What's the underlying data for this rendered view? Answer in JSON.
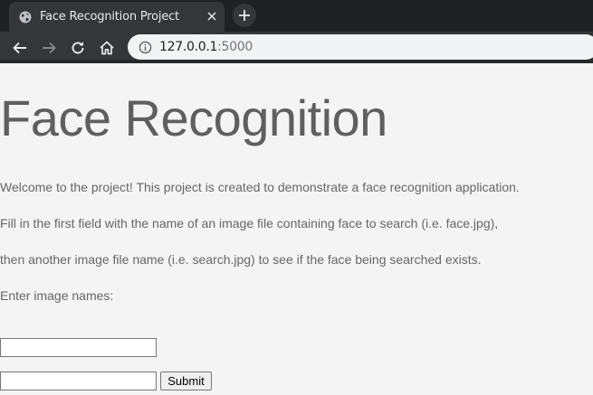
{
  "browser": {
    "tab_title": "Face Recognition Project",
    "url_host": "127.0.0.1",
    "url_port": ":5000"
  },
  "page": {
    "heading": "Face Recognition",
    "intro": "Welcome to the project! This project is created to demonstrate a face recognition application.",
    "instruction_1": "Fill in the first field with the name of an image file containing face to search (i.e. face.jpg),",
    "instruction_2": "then another image file name (i.e. search.jpg) to see if the face being searched exists.",
    "prompt": "Enter image names:",
    "field_1_value": "",
    "field_2_value": "",
    "submit_label": "Submit"
  },
  "colors": {
    "tabstrip": "#202124",
    "toolbar": "#35363a",
    "page_background": "#f4f4f4",
    "heading_text": "#5f5f5f",
    "body_text": "#666666"
  },
  "icons": [
    "globe-icon",
    "close-icon",
    "plus-icon",
    "back-arrow-icon",
    "forward-arrow-icon",
    "reload-icon",
    "home-icon",
    "info-icon"
  ]
}
